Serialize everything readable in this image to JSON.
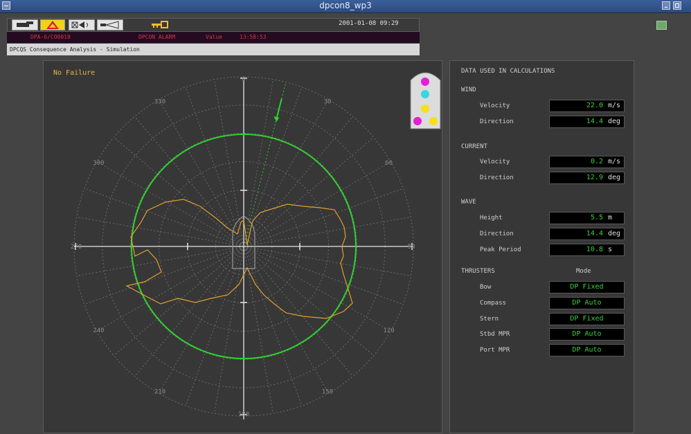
{
  "window": {
    "title": "dpcon8_wp3"
  },
  "toolbar": {
    "datetime": "2001-01-08  09:29"
  },
  "alarm": {
    "source": "DPA-6/CO0018",
    "type": "DPCON ALARM",
    "value_label": "Value",
    "time": "13:58:53"
  },
  "status": {
    "text": "DPCQS  Consequence Analysis - Simulation"
  },
  "plot": {
    "status_label": "No Failure",
    "bearing_labels": [
      "0",
      "30",
      "60",
      "90",
      "120",
      "150",
      "180",
      "210",
      "240",
      "270",
      "300",
      "330"
    ],
    "thruster_indicators": [
      "#e41fd6",
      "#38d6e0",
      "#f5e01a",
      "#e41fd6",
      "#f5e01a"
    ]
  },
  "data": {
    "header": "DATA USED IN CALCULATIONS",
    "wind": {
      "label": "WIND",
      "velocity": {
        "label": "Velocity",
        "value": "22.0",
        "unit": "m/s"
      },
      "direction": {
        "label": "Direction",
        "value": "14.4",
        "unit": "deg"
      }
    },
    "current": {
      "label": "CURRENT",
      "velocity": {
        "label": "Velocity",
        "value": "0.2",
        "unit": "m/s"
      },
      "direction": {
        "label": "Direction",
        "value": "12.9",
        "unit": "deg"
      }
    },
    "wave": {
      "label": "WAVE",
      "height": {
        "label": "Height",
        "value": "5.5",
        "unit": "m"
      },
      "direction": {
        "label": "Direction",
        "value": "14.4",
        "unit": "deg"
      },
      "period": {
        "label": "Peak Period",
        "value": "10.8",
        "unit": "s"
      }
    },
    "thrusters": {
      "label": "THRUSTERS",
      "mode_header": "Mode",
      "items": [
        {
          "label": "Bow",
          "mode": "DP Fixed"
        },
        {
          "label": "Compass",
          "mode": "DP Auto"
        },
        {
          "label": "Stern",
          "mode": "DP Fixed"
        },
        {
          "label": "Stbd MPR",
          "mode": "DP Auto"
        },
        {
          "label": "Port MPR",
          "mode": "DP Auto"
        }
      ]
    }
  },
  "colors": {
    "capability": "#e0a030",
    "limit": "#2ed12e",
    "wind": "#2ed12e",
    "grid": "#6b6b6b"
  }
}
